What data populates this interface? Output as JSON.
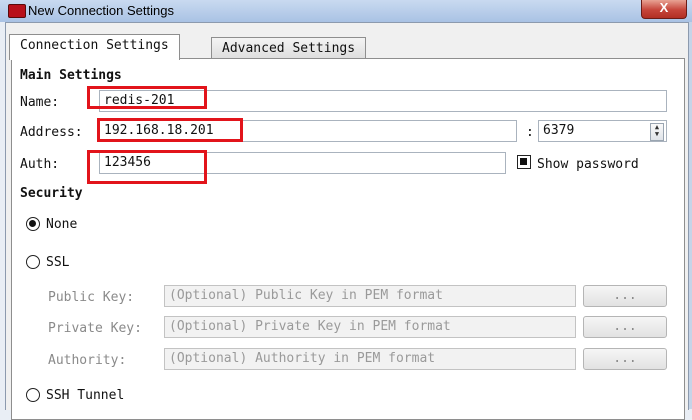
{
  "window": {
    "title": "New Connection Settings",
    "close_symbol": "X"
  },
  "tabs": [
    {
      "label": "Connection Settings",
      "active": true
    },
    {
      "label": "Advanced Settings",
      "active": false
    }
  ],
  "main_settings": {
    "heading": "Main Settings",
    "name_label": "Name:",
    "name_value": "redis-201",
    "address_label": "Address:",
    "address_value": "192.168.18.201",
    "port_separator": ":",
    "port_value": "6379",
    "auth_label": "Auth:",
    "auth_value": "123456",
    "show_password_label": "Show password",
    "show_password_checked": true
  },
  "security": {
    "heading": "Security",
    "options": [
      {
        "label": "None",
        "selected": true
      },
      {
        "label": "SSL",
        "selected": false
      },
      {
        "label": "SSH Tunnel",
        "selected": false
      }
    ],
    "ssl": {
      "public_key_label": "Public Key:",
      "public_key_placeholder": "(Optional) Public Key in PEM format",
      "private_key_label": "Private Key:",
      "private_key_placeholder": "(Optional) Private Key in PEM format",
      "authority_label": "Authority:",
      "authority_placeholder": "(Optional) Authority in PEM format",
      "browse_label": "..."
    }
  },
  "colors": {
    "highlight": "#e2141b",
    "close_button": "#c6453a",
    "title_bar": "#b9cfec"
  }
}
